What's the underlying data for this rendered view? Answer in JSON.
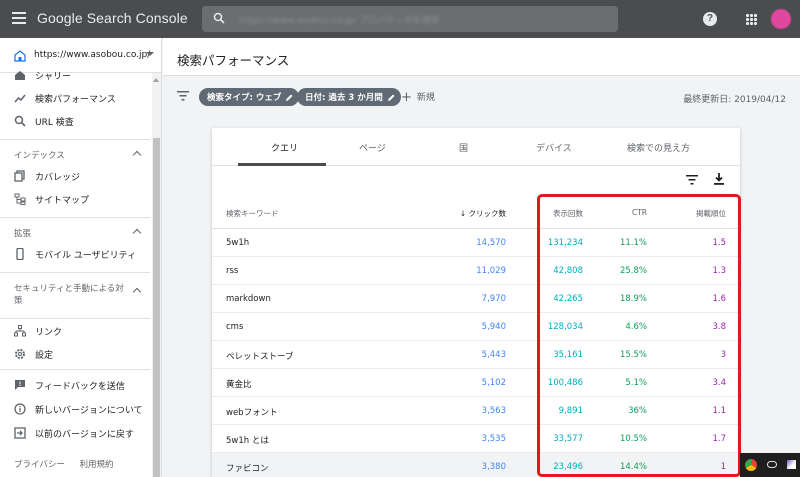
{
  "app": {
    "brand": "Google Search Console",
    "search_value": "https://www.asobou.co.jp/ プロパティ内を検索"
  },
  "sidebar": {
    "property": "https://www.asobou.co.jp/",
    "items": [
      {
        "label": "シャリー",
        "icon": "home-icon"
      },
      {
        "label": "検索パフォーマンス",
        "icon": "trending-up-icon"
      },
      {
        "label": "URL 検査",
        "icon": "search-icon"
      }
    ],
    "sections": [
      {
        "title": "インデックス",
        "items": [
          {
            "label": "カバレッジ",
            "icon": "copy-icon"
          },
          {
            "label": "サイトマップ",
            "icon": "sitemap-icon"
          }
        ]
      },
      {
        "title": "拡張",
        "items": [
          {
            "label": "モバイル ユーザビリティ",
            "icon": "smartphone-icon"
          }
        ]
      },
      {
        "title": "セキュリティと手動による対策",
        "items": []
      }
    ],
    "bottom_items": [
      {
        "label": "リンク",
        "icon": "link-tree-icon"
      },
      {
        "label": "設定",
        "icon": "gear-icon"
      },
      {
        "label": "フィードバックを送信",
        "icon": "feedback-icon"
      },
      {
        "label": "新しいバージョンについて",
        "icon": "info-icon"
      },
      {
        "label": "以前のバージョンに戻す",
        "icon": "exit-icon"
      }
    ],
    "footer": [
      "プライバシー",
      "利用規約"
    ]
  },
  "main": {
    "title": "検索パフォーマンス",
    "filters": [
      {
        "label": "検索タイプ: ウェブ"
      },
      {
        "label": "日付: 過去 3 か月間"
      }
    ],
    "new_label": "新規",
    "updated": "最終更新日: 2019/04/12",
    "tabs": [
      "クエリ",
      "ページ",
      "国",
      "デバイス",
      "検索での見え方"
    ],
    "columns": {
      "query": "検索キーワード",
      "clicks": "クリック数",
      "impressions": "表示回数",
      "ctr": "CTR",
      "position": "掲載順位"
    },
    "rows": [
      {
        "query": "5w1h",
        "clicks": "14,570",
        "impressions": "131,234",
        "ctr": "11.1%",
        "position": "1.5"
      },
      {
        "query": "rss",
        "clicks": "11,029",
        "impressions": "42,808",
        "ctr": "25.8%",
        "position": "1.3"
      },
      {
        "query": "markdown",
        "clicks": "7,970",
        "impressions": "42,265",
        "ctr": "18.9%",
        "position": "1.6"
      },
      {
        "query": "cms",
        "clicks": "5,940",
        "impressions": "128,034",
        "ctr": "4.6%",
        "position": "3.8"
      },
      {
        "query": "ペレットストーブ",
        "clicks": "5,443",
        "impressions": "35,161",
        "ctr": "15.5%",
        "position": "3"
      },
      {
        "query": "黄金比",
        "clicks": "5,102",
        "impressions": "100,486",
        "ctr": "5.1%",
        "position": "3.4"
      },
      {
        "query": "webフォント",
        "clicks": "3,563",
        "impressions": "9,891",
        "ctr": "36%",
        "position": "1.1"
      },
      {
        "query": "5w1h とは",
        "clicks": "3,535",
        "impressions": "33,577",
        "ctr": "10.5%",
        "position": "1.7"
      },
      {
        "query": "ファビコン",
        "clicks": "3,380",
        "impressions": "23,496",
        "ctr": "14.4%",
        "position": "1"
      }
    ]
  },
  "colors": {
    "topbar": "#4a4c50",
    "clicks": "#4285f4",
    "impressions": "#00acc1",
    "ctr": "#0f9d58",
    "position": "#9c27b0",
    "highlight": "#e5161d"
  }
}
